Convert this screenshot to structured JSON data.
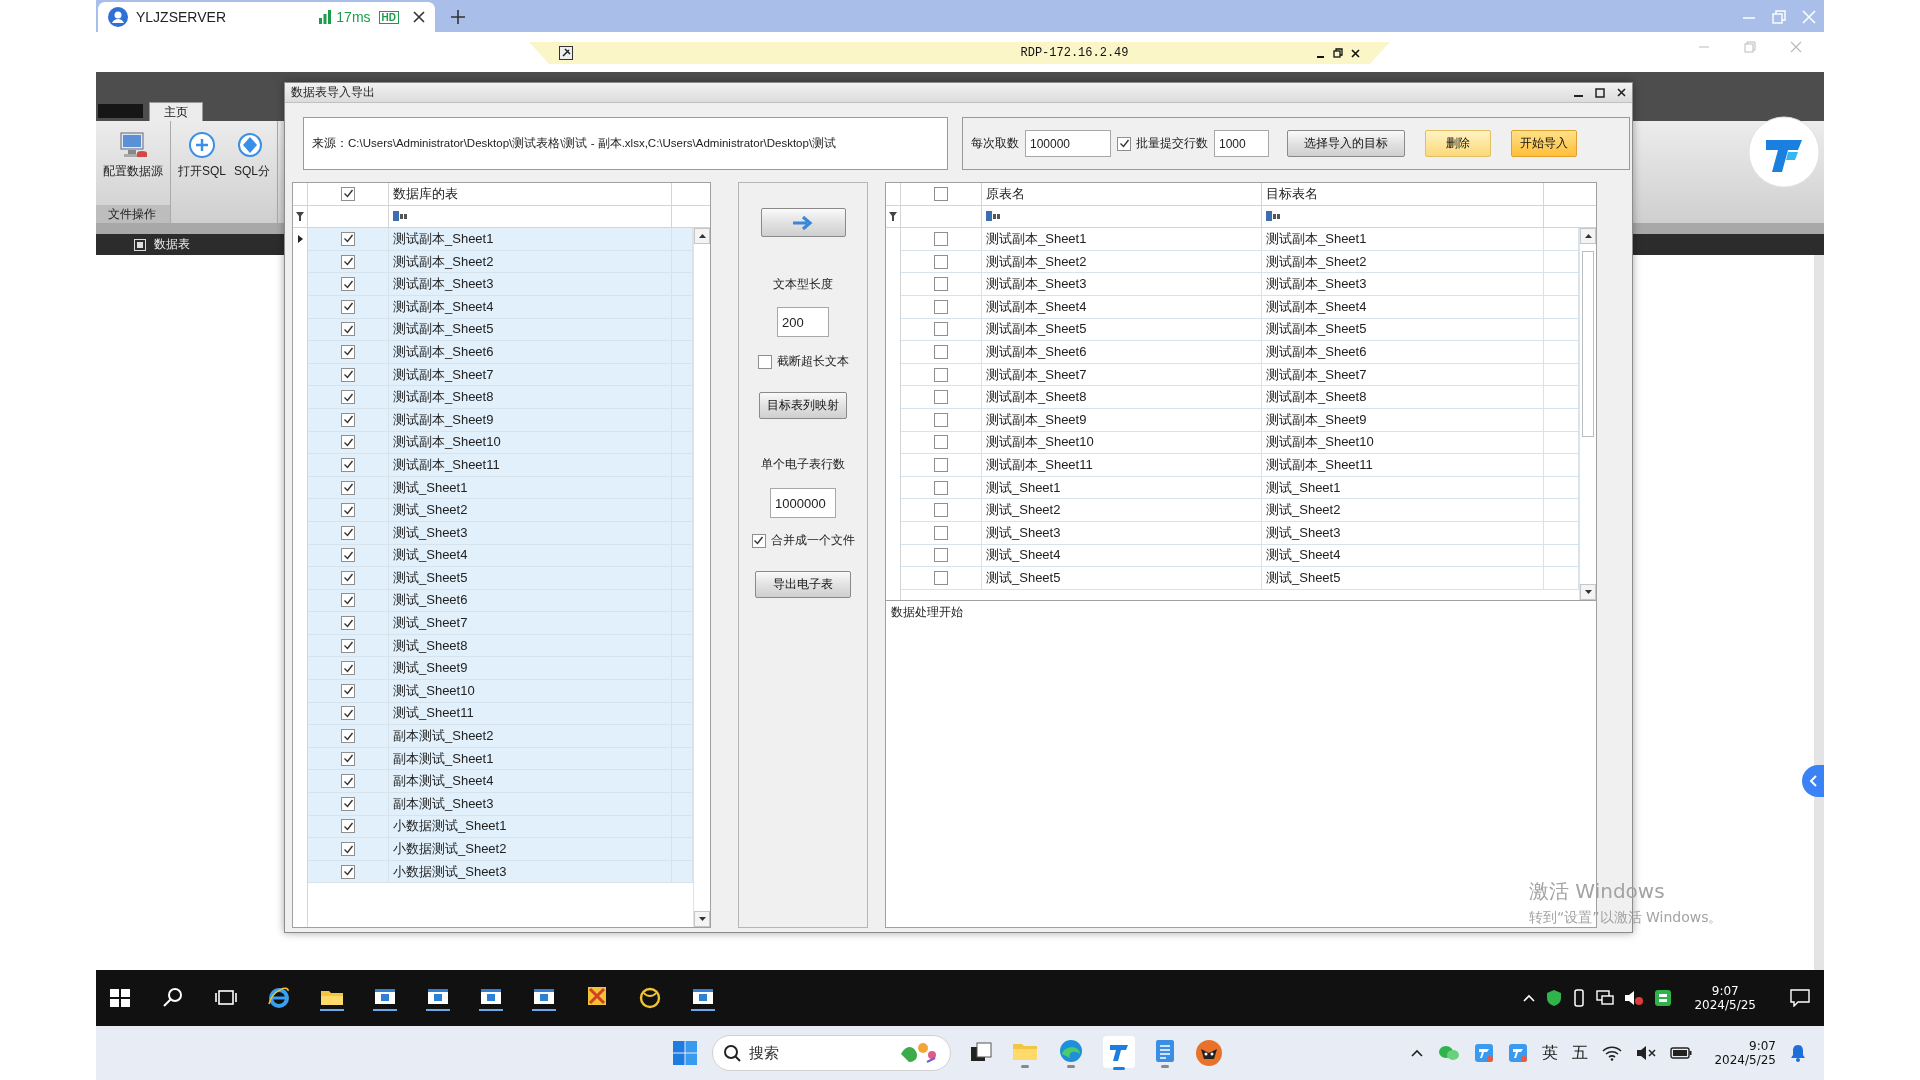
{
  "browser_tab": {
    "title": "YLJZSERVER",
    "latency": "17ms",
    "quality": "HD"
  },
  "rdp_bar": {
    "title": "RDP-172.16.2.49"
  },
  "ribbon": {
    "tabs": [
      {
        "label": "主页",
        "selected": true
      }
    ],
    "groups": [
      {
        "label": "文件操作",
        "buttons": [
          {
            "label": "配置数据源",
            "kind": "datasource"
          }
        ]
      },
      {
        "buttons": [
          {
            "label": "打开SQL",
            "kind": "add"
          },
          {
            "label": "SQL分",
            "kind": "sql"
          }
        ]
      }
    ]
  },
  "document_tab": {
    "label": "数据表"
  },
  "dialog": {
    "title": "数据表导入导出",
    "source": "来源：C:\\Users\\Administrator\\Desktop\\测试表格\\测试 - 副本.xlsx,C:\\Users\\Administrator\\Desktop\\测试",
    "batch_label": "每次取数",
    "batch_value": "100000",
    "commit": {
      "label": "批量提交行数",
      "checked": true
    },
    "commit_value": "1000",
    "actions": [
      {
        "label": "选择导入的目标",
        "kind": "normal"
      },
      {
        "label": "删除",
        "kind": "warning"
      },
      {
        "label": "开始导入",
        "kind": "primary"
      }
    ],
    "db_tables": {
      "header_checked": true,
      "columns": [
        "数据库的表"
      ],
      "rows": [
        {
          "cells": [
            "测试副本_Sheet1"
          ],
          "checked": true,
          "selected": true,
          "current": true
        },
        {
          "cells": [
            "测试副本_Sheet2"
          ],
          "checked": true,
          "selected": true,
          "current": false
        },
        {
          "cells": [
            "测试副本_Sheet3"
          ],
          "checked": true,
          "selected": true,
          "current": false
        },
        {
          "cells": [
            "测试副本_Sheet4"
          ],
          "checked": true,
          "selected": true,
          "current": false
        },
        {
          "cells": [
            "测试副本_Sheet5"
          ],
          "checked": true,
          "selected": true,
          "current": false
        },
        {
          "cells": [
            "测试副本_Sheet6"
          ],
          "checked": true,
          "selected": true,
          "current": false
        },
        {
          "cells": [
            "测试副本_Sheet7"
          ],
          "checked": true,
          "selected": true,
          "current": false
        },
        {
          "cells": [
            "测试副本_Sheet8"
          ],
          "checked": true,
          "selected": true,
          "current": false
        },
        {
          "cells": [
            "测试副本_Sheet9"
          ],
          "checked": true,
          "selected": true,
          "current": false
        },
        {
          "cells": [
            "测试副本_Sheet10"
          ],
          "checked": true,
          "selected": true,
          "current": false
        },
        {
          "cells": [
            "测试副本_Sheet11"
          ],
          "checked": true,
          "selected": true,
          "current": false
        },
        {
          "cells": [
            "测试_Sheet1"
          ],
          "checked": true,
          "selected": true,
          "current": false
        },
        {
          "cells": [
            "测试_Sheet2"
          ],
          "checked": true,
          "selected": true,
          "current": false
        },
        {
          "cells": [
            "测试_Sheet3"
          ],
          "checked": true,
          "selected": true,
          "current": false
        },
        {
          "cells": [
            "测试_Sheet4"
          ],
          "checked": true,
          "selected": true,
          "current": false
        },
        {
          "cells": [
            "测试_Sheet5"
          ],
          "checked": true,
          "selected": true,
          "current": false
        },
        {
          "cells": [
            "测试_Sheet6"
          ],
          "checked": true,
          "selected": true,
          "current": false
        },
        {
          "cells": [
            "测试_Sheet7"
          ],
          "checked": true,
          "selected": true,
          "current": false
        },
        {
          "cells": [
            "测试_Sheet8"
          ],
          "checked": true,
          "selected": true,
          "current": false
        },
        {
          "cells": [
            "测试_Sheet9"
          ],
          "checked": true,
          "selected": true,
          "current": false
        },
        {
          "cells": [
            "测试_Sheet10"
          ],
          "checked": true,
          "selected": true,
          "current": false
        },
        {
          "cells": [
            "测试_Sheet11"
          ],
          "checked": true,
          "selected": true,
          "current": false
        },
        {
          "cells": [
            "副本测试_Sheet2"
          ],
          "checked": true,
          "selected": true,
          "current": false
        },
        {
          "cells": [
            "副本测试_Sheet1"
          ],
          "checked": true,
          "selected": true,
          "current": false
        },
        {
          "cells": [
            "副本测试_Sheet4"
          ],
          "checked": true,
          "selected": true,
          "current": false
        },
        {
          "cells": [
            "副本测试_Sheet3"
          ],
          "checked": true,
          "selected": true,
          "current": false
        },
        {
          "cells": [
            "小数据测试_Sheet1"
          ],
          "checked": true,
          "selected": true,
          "current": false
        },
        {
          "cells": [
            "小数据测试_Sheet2"
          ],
          "checked": true,
          "selected": true,
          "current": false
        },
        {
          "cells": [
            "小数据测试_Sheet3"
          ],
          "checked": true,
          "selected": true,
          "current": false
        }
      ]
    },
    "export_panel": {
      "text_length_label": "文本型长度",
      "text_length_value": "200",
      "truncate": {
        "label": "截断超长文本",
        "checked": false
      },
      "mapping_button": "目标表列映射",
      "rows_label": "单个电子表行数",
      "rows_value": "1000000",
      "merge": {
        "label": "合并成一个文件",
        "checked": true
      },
      "export_button": "导出电子表"
    },
    "mapping": {
      "header_checked": false,
      "columns": [
        "原表名",
        "目标表名"
      ],
      "rows": [
        {
          "cells": [
            "测试副本_Sheet1",
            "测试副本_Sheet1"
          ],
          "checked": false,
          "selected": false,
          "current": false
        },
        {
          "cells": [
            "测试副本_Sheet2",
            "测试副本_Sheet2"
          ],
          "checked": false,
          "selected": false,
          "current": false
        },
        {
          "cells": [
            "测试副本_Sheet3",
            "测试副本_Sheet3"
          ],
          "checked": false,
          "selected": false,
          "current": false
        },
        {
          "cells": [
            "测试副本_Sheet4",
            "测试副本_Sheet4"
          ],
          "checked": false,
          "selected": false,
          "current": false
        },
        {
          "cells": [
            "测试副本_Sheet5",
            "测试副本_Sheet5"
          ],
          "checked": false,
          "selected": false,
          "current": false
        },
        {
          "cells": [
            "测试副本_Sheet6",
            "测试副本_Sheet6"
          ],
          "checked": false,
          "selected": false,
          "current": false
        },
        {
          "cells": [
            "测试副本_Sheet7",
            "测试副本_Sheet7"
          ],
          "checked": false,
          "selected": false,
          "current": false
        },
        {
          "cells": [
            "测试副本_Sheet8",
            "测试副本_Sheet8"
          ],
          "checked": false,
          "selected": false,
          "current": false
        },
        {
          "cells": [
            "测试副本_Sheet9",
            "测试副本_Sheet9"
          ],
          "checked": false,
          "selected": false,
          "current": false
        },
        {
          "cells": [
            "测试副本_Sheet10",
            "测试副本_Sheet10"
          ],
          "checked": false,
          "selected": false,
          "current": false
        },
        {
          "cells": [
            "测试副本_Sheet11",
            "测试副本_Sheet11"
          ],
          "checked": false,
          "selected": false,
          "current": false
        },
        {
          "cells": [
            "测试_Sheet1",
            "测试_Sheet1"
          ],
          "checked": false,
          "selected": false,
          "current": false
        },
        {
          "cells": [
            "测试_Sheet2",
            "测试_Sheet2"
          ],
          "checked": false,
          "selected": false,
          "current": false
        },
        {
          "cells": [
            "测试_Sheet3",
            "测试_Sheet3"
          ],
          "checked": false,
          "selected": false,
          "current": false
        },
        {
          "cells": [
            "测试_Sheet4",
            "测试_Sheet4"
          ],
          "checked": false,
          "selected": false,
          "current": false
        },
        {
          "cells": [
            "测试_Sheet5",
            "测试_Sheet5"
          ],
          "checked": false,
          "selected": false,
          "current": false
        }
      ]
    },
    "log": "数据处理开始"
  },
  "activation": {
    "title": "激活 Windows",
    "hint": "转到“设置”以激活 Windows。"
  },
  "remote_taskbar": {
    "time": "9:07",
    "date": "2024/5/25"
  },
  "local_taskbar": {
    "search_placeholder": "搜索",
    "ime_language": "英",
    "ime_mode": "五",
    "time": "9:07",
    "date": "2024/5/25"
  }
}
